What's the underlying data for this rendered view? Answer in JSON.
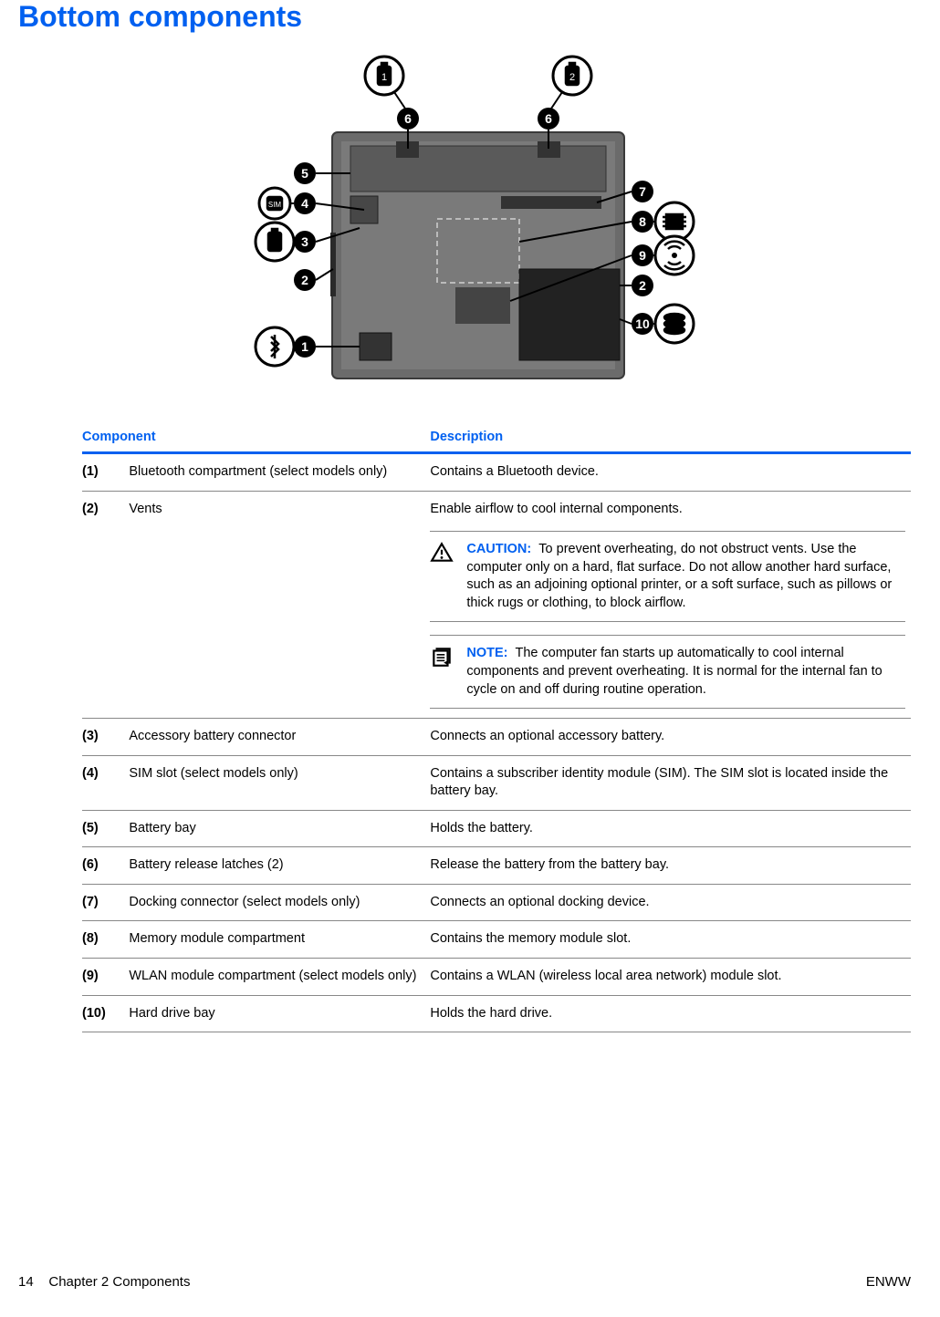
{
  "title": "Bottom components",
  "table": {
    "headers": {
      "component": "Component",
      "description": "Description"
    },
    "rows": [
      {
        "idx": "(1)",
        "component": "Bluetooth compartment (select models only)",
        "description": "Contains a Bluetooth device."
      },
      {
        "idx": "(2)",
        "component": "Vents",
        "description": "Enable airflow to cool internal components.",
        "callouts": [
          {
            "type": "caution",
            "label": "CAUTION:",
            "text": "To prevent overheating, do not obstruct vents. Use the computer only on a hard, flat surface. Do not allow another hard surface, such as an adjoining optional printer, or a soft surface, such as pillows or thick rugs or clothing, to block airflow."
          },
          {
            "type": "note",
            "label": "NOTE:",
            "text": "The computer fan starts up automatically to cool internal components and prevent overheating. It is normal for the internal fan to cycle on and off during routine operation."
          }
        ]
      },
      {
        "idx": "(3)",
        "component": "Accessory battery connector",
        "description": "Connects an optional accessory battery."
      },
      {
        "idx": "(4)",
        "component": "SIM slot (select models only)",
        "description": "Contains a subscriber identity module (SIM). The SIM slot is located inside the battery bay."
      },
      {
        "idx": "(5)",
        "component": "Battery bay",
        "description": "Holds the battery."
      },
      {
        "idx": "(6)",
        "component": "Battery release latches (2)",
        "description": "Release the battery from the battery bay."
      },
      {
        "idx": "(7)",
        "component": "Docking connector (select models only)",
        "description": "Connects an optional docking device."
      },
      {
        "idx": "(8)",
        "component": "Memory module compartment",
        "description": "Contains the memory module slot."
      },
      {
        "idx": "(9)",
        "component": "WLAN module compartment (select models only)",
        "description": "Contains a WLAN (wireless local area network) module slot."
      },
      {
        "idx": "(10)",
        "component": "Hard drive bay",
        "description": "Holds the hard drive."
      }
    ]
  },
  "footer": {
    "left_page": "14",
    "left_text": "Chapter 2   Components",
    "right": "ENWW"
  }
}
